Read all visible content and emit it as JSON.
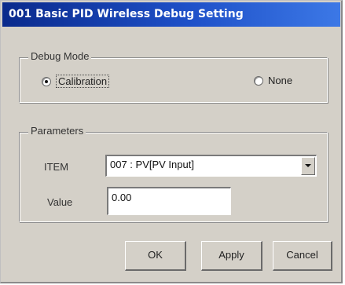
{
  "window": {
    "title": "001 Basic PID Wireless Debug Setting"
  },
  "debug_mode": {
    "legend": "Debug Mode",
    "options": [
      {
        "label": "Calibration",
        "selected": true
      },
      {
        "label": "None",
        "selected": false
      }
    ]
  },
  "parameters": {
    "legend": "Parameters",
    "item_label": "ITEM",
    "item_selected": "007 : PV[PV Input]",
    "value_label": "Value",
    "value": "0.00"
  },
  "buttons": {
    "ok": "OK",
    "apply": "Apply",
    "cancel": "Cancel"
  },
  "colors": {
    "title_bar": "#1e50c8",
    "face": "#d4d0c8"
  }
}
